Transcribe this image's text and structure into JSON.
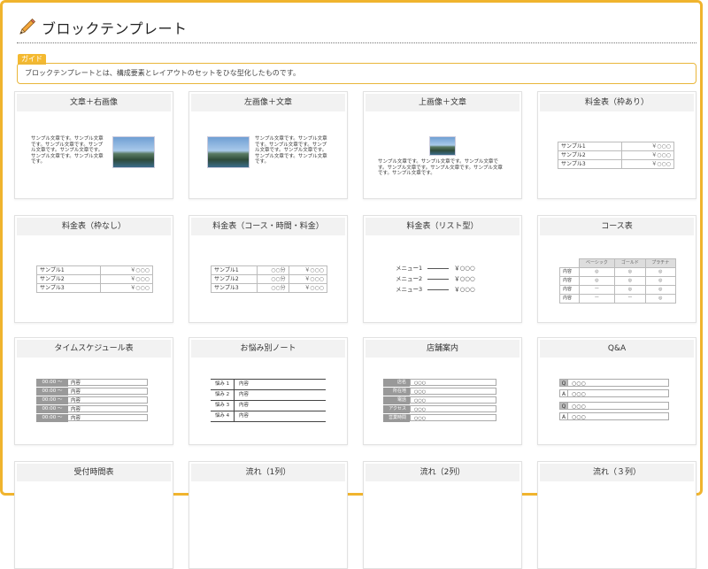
{
  "header": {
    "title": "ブロックテンプレート"
  },
  "guide": {
    "tag": "ガイド",
    "text": "ブロックテンプレートとは、構成要素とレイアウトのセットをひな型化したものです。"
  },
  "sample_text": "サンプル文章です。サンプル文章です。サンプル文章です。サンプル文章です。サンプル文章です。サンプル文章です。サンプル文章です。",
  "sample_text_wide": "サンプル文章です。サンプル文章です。サンプル文章です。サンプル文章です。サンプル文章です。サンプル文章です。サンプル文章です。",
  "cards": [
    {
      "title": "文章＋右画像"
    },
    {
      "title": "左画像＋文章"
    },
    {
      "title": "上画像＋文章"
    },
    {
      "title": "料金表（枠あり）"
    },
    {
      "title": "料金表（枠なし）"
    },
    {
      "title": "料金表（コース・時間・料金）"
    },
    {
      "title": "料金表（リスト型）"
    },
    {
      "title": "コース表"
    },
    {
      "title": "タイムスケジュール表"
    },
    {
      "title": "お悩み別ノート"
    },
    {
      "title": "店舗案内"
    },
    {
      "title": "Q&A"
    },
    {
      "title": "受付時間表"
    },
    {
      "title": "流れ（1列）"
    },
    {
      "title": "流れ（2列）"
    },
    {
      "title": "流れ（３列）"
    }
  ],
  "price": {
    "items": [
      "サンプル1",
      "サンプル2",
      "サンプル3"
    ],
    "price": "￥○○○",
    "time": "○○分"
  },
  "list_price": {
    "items": [
      "メニュー1",
      "メニュー2",
      "メニュー3"
    ],
    "price": "￥○○○"
  },
  "course": {
    "headers": [
      "ベーシック",
      "ゴールド",
      "プラチナ"
    ],
    "row_label": "内容",
    "rows": [
      [
        "◎",
        "◎",
        "◎"
      ],
      [
        "◎",
        "◎",
        "◎"
      ],
      [
        "ー",
        "◎",
        "◎"
      ],
      [
        "ー",
        "ー",
        "◎"
      ]
    ]
  },
  "timeschedule": {
    "time": "00:00 ～",
    "content": "内容"
  },
  "notes": {
    "items": [
      "悩み 1",
      "悩み 2",
      "悩み 3",
      "悩み 4"
    ],
    "content": "内容"
  },
  "shop": {
    "labels": [
      "店名",
      "所在地",
      "電話",
      "アクセス",
      "営業時間"
    ],
    "value": "○○○"
  },
  "qa": {
    "labels": [
      "Q",
      "A",
      "Q",
      "A"
    ],
    "value": "○○○"
  }
}
